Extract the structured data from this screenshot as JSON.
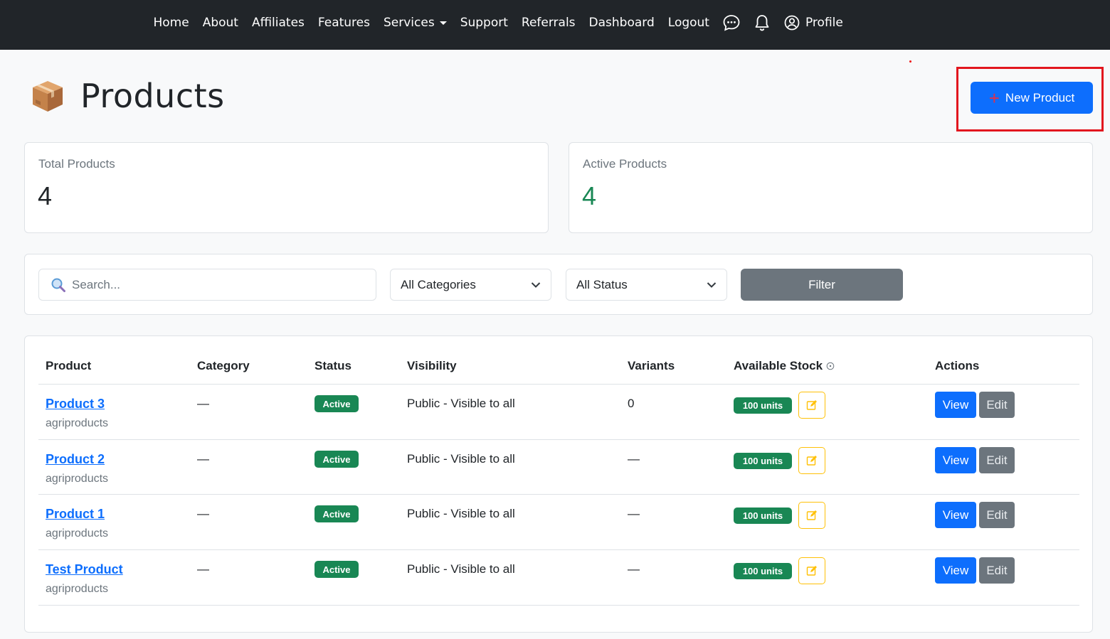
{
  "nav": {
    "home": "Home",
    "about": "About",
    "affiliates": "Affiliates",
    "features": "Features",
    "services": "Services",
    "support": "Support",
    "referrals": "Referrals",
    "dashboard": "Dashboard",
    "logout": "Logout",
    "profile": "Profile",
    "icons": [
      "chat-dots-icon",
      "bell-icon",
      "person-circle-icon"
    ]
  },
  "page": {
    "title": "Products",
    "icon": "package-box-icon",
    "new_button": "New Product"
  },
  "stats": {
    "total_label": "Total Products",
    "total_value": "4",
    "active_label": "Active Products",
    "active_value": "4"
  },
  "filters": {
    "search_placeholder": "Search...",
    "category": "All Categories",
    "status": "All Status",
    "filter_button": "Filter"
  },
  "table": {
    "headers": {
      "product": "Product",
      "category": "Category",
      "status": "Status",
      "visibility": "Visibility",
      "variants": "Variants",
      "stock": "Available Stock",
      "actions": "Actions"
    },
    "rows": [
      {
        "name": "Product 3",
        "vendor": "agriproducts",
        "category": "—",
        "status": "Active",
        "visibility": "Public - Visible to all",
        "variants": "0",
        "stock": "100 units",
        "view": "View",
        "edit": "Edit"
      },
      {
        "name": "Product 2",
        "vendor": "agriproducts",
        "category": "—",
        "status": "Active",
        "visibility": "Public - Visible to all",
        "variants": "—",
        "stock": "100 units",
        "view": "View",
        "edit": "Edit"
      },
      {
        "name": "Product 1",
        "vendor": "agriproducts",
        "category": "—",
        "status": "Active",
        "visibility": "Public - Visible to all",
        "variants": "—",
        "stock": "100 units",
        "view": "View",
        "edit": "Edit"
      },
      {
        "name": "Test Product",
        "vendor": "agriproducts",
        "category": "—",
        "status": "Active",
        "visibility": "Public - Visible to all",
        "variants": "—",
        "stock": "100 units",
        "view": "View",
        "edit": "Edit"
      }
    ]
  },
  "colors": {
    "navbar": "#212529",
    "primary": "#0d6efd",
    "success": "#198754",
    "secondary": "#6c757d",
    "warning": "#ffc107",
    "highlight": "#e2161e"
  }
}
